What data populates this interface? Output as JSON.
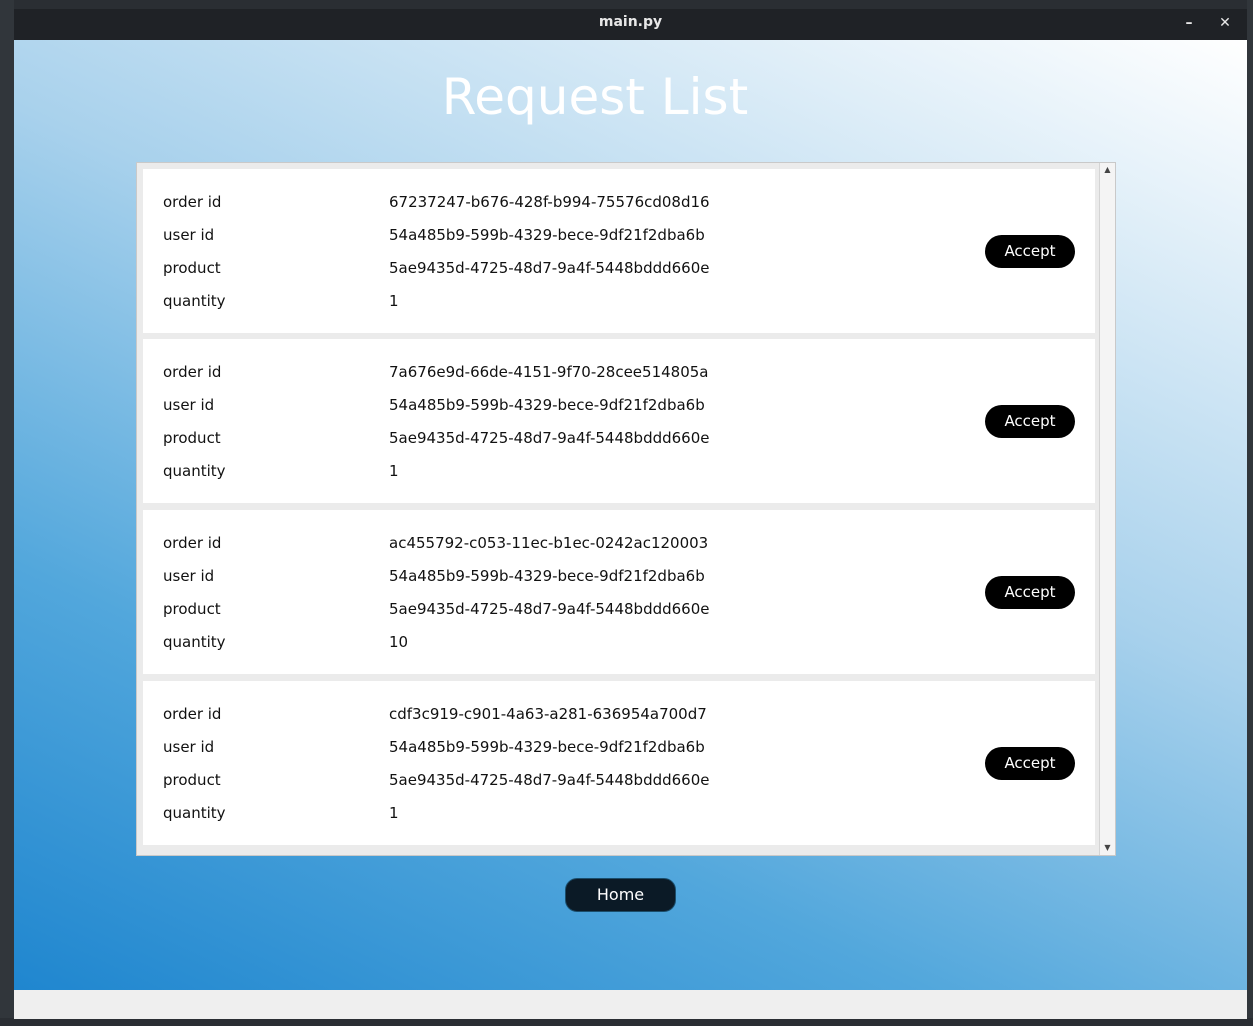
{
  "window": {
    "title": "main.py",
    "minimize_label": "–",
    "close_label": "✕"
  },
  "page": {
    "title": "Request List",
    "home_label": "Home"
  },
  "labels": {
    "order_id": "order id",
    "user_id": "user id",
    "product": "product",
    "quantity": "quantity",
    "accept": "Accept"
  },
  "requests": [
    {
      "order_id": "67237247-b676-428f-b994-75576cd08d16",
      "user_id": "54a485b9-599b-4329-bece-9df21f2dba6b",
      "product": "5ae9435d-4725-48d7-9a4f-5448bddd660e",
      "quantity": "1"
    },
    {
      "order_id": "7a676e9d-66de-4151-9f70-28cee514805a",
      "user_id": "54a485b9-599b-4329-bece-9df21f2dba6b",
      "product": "5ae9435d-4725-48d7-9a4f-5448bddd660e",
      "quantity": "1"
    },
    {
      "order_id": "ac455792-c053-11ec-b1ec-0242ac120003",
      "user_id": "54a485b9-599b-4329-bece-9df21f2dba6b",
      "product": "5ae9435d-4725-48d7-9a4f-5448bddd660e",
      "quantity": "10"
    },
    {
      "order_id": "cdf3c919-c901-4a63-a281-636954a700d7",
      "user_id": "54a485b9-599b-4329-bece-9df21f2dba6b",
      "product": "5ae9435d-4725-48d7-9a4f-5448bddd660e",
      "quantity": "1"
    }
  ],
  "colors": {
    "accent_button": "#000000",
    "home_button": "#0b1a26",
    "gradient_dark": "#1f86cf",
    "gradient_light": "#ffffff"
  }
}
